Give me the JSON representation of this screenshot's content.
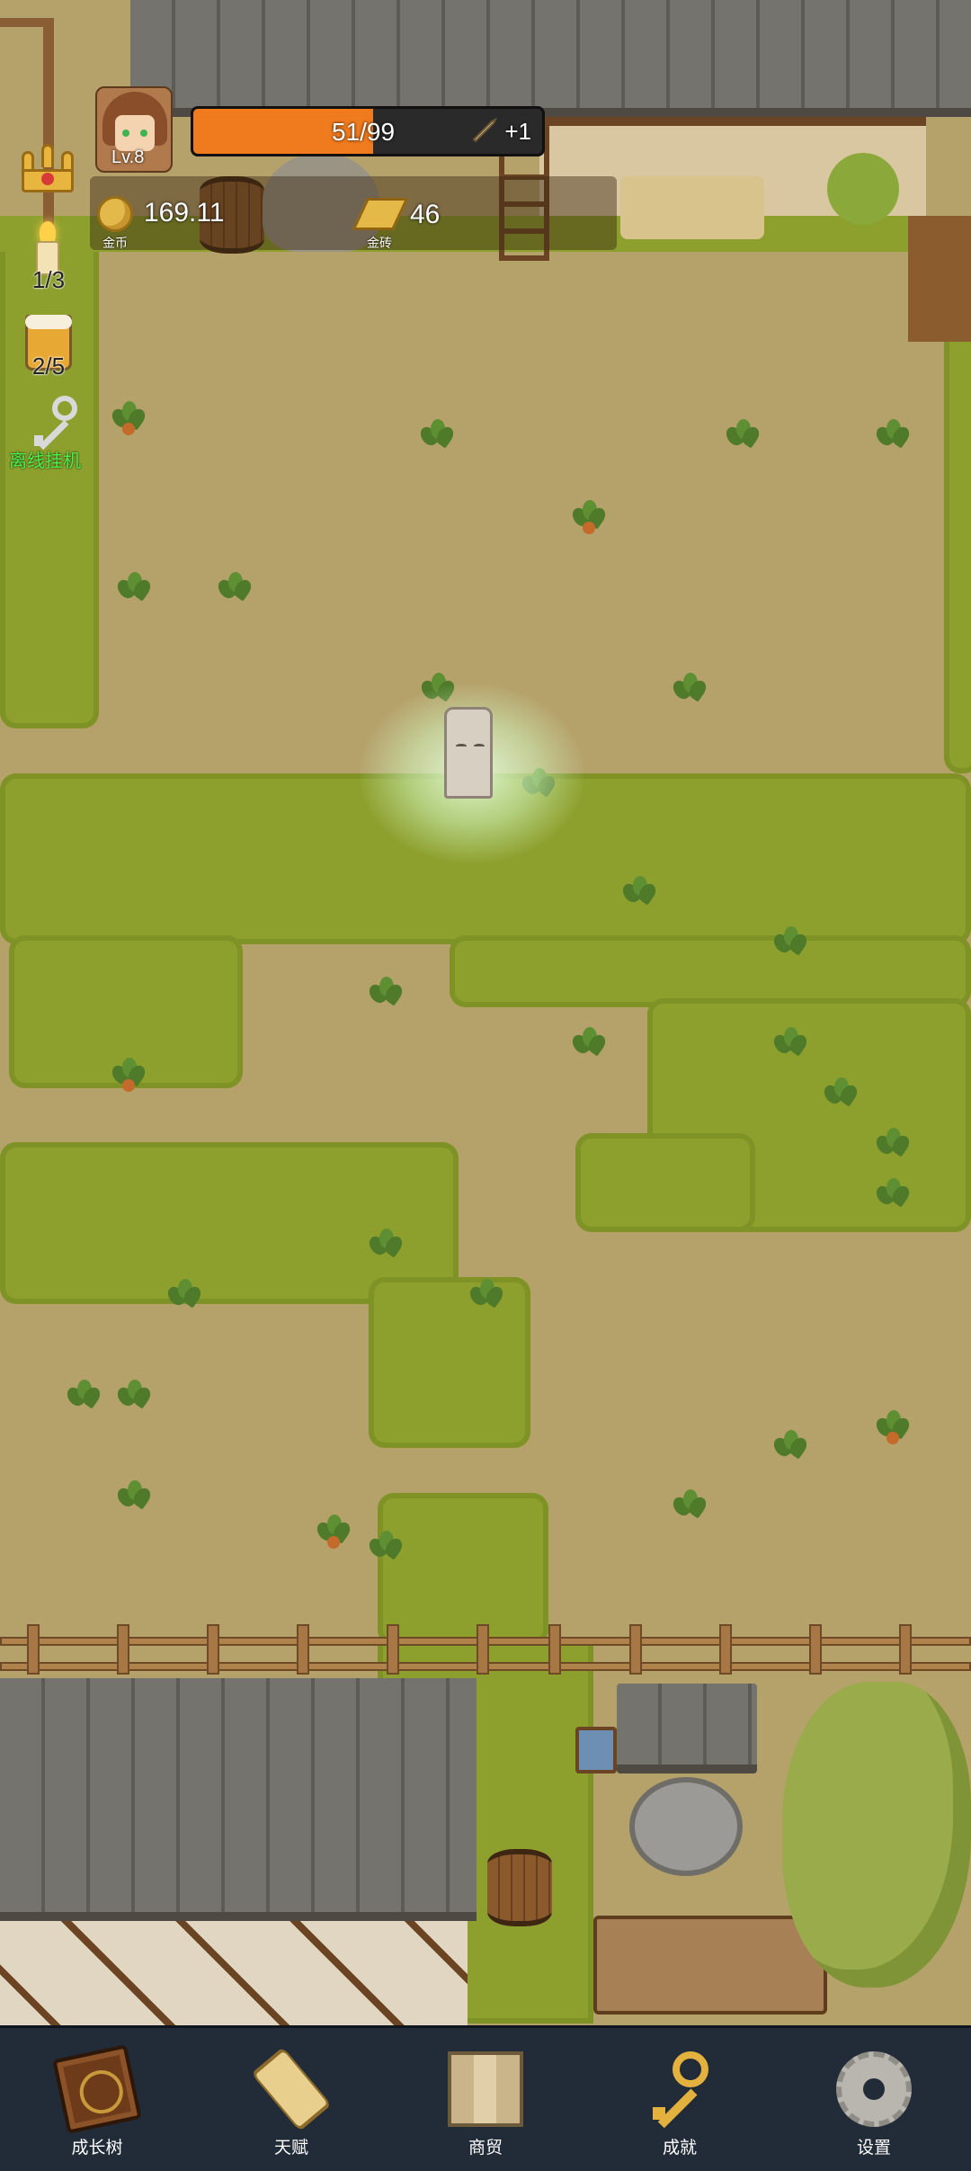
{
  "player": {
    "level_label": "Lv.8",
    "xp_text": "51/99",
    "xp_current": 51,
    "xp_max": 99,
    "bonus_text": "+1"
  },
  "resources": {
    "coins": {
      "value": "169.11",
      "label": "金币",
      "icon": "gold-coin-icon"
    },
    "gold_bricks": {
      "value": "46",
      "label": "金砖",
      "icon": "gold-bar-icon"
    }
  },
  "side_panel": {
    "crown": {
      "icon": "crown-icon"
    },
    "candle": {
      "count": "1/3",
      "icon": "candle-icon"
    },
    "beer": {
      "count": "2/5",
      "icon": "beer-mug-icon"
    },
    "auto_idle": {
      "label": "离线挂机",
      "icon": "key-icon"
    }
  },
  "bottom_nav": [
    {
      "label": "成长树",
      "icon": "book-icon"
    },
    {
      "label": "天赋",
      "icon": "scroll-icon"
    },
    {
      "label": "商贸",
      "icon": "map-icon"
    },
    {
      "label": "成就",
      "icon": "golden-key-icon"
    },
    {
      "label": "设置",
      "icon": "gear-icon"
    }
  ],
  "colors": {
    "xp_fill": "#f07a1e",
    "nav_bg": "#222b38",
    "grass": "#8d9f2d",
    "dirt": "#b8a36c",
    "idle_label": "#4cf24c"
  }
}
